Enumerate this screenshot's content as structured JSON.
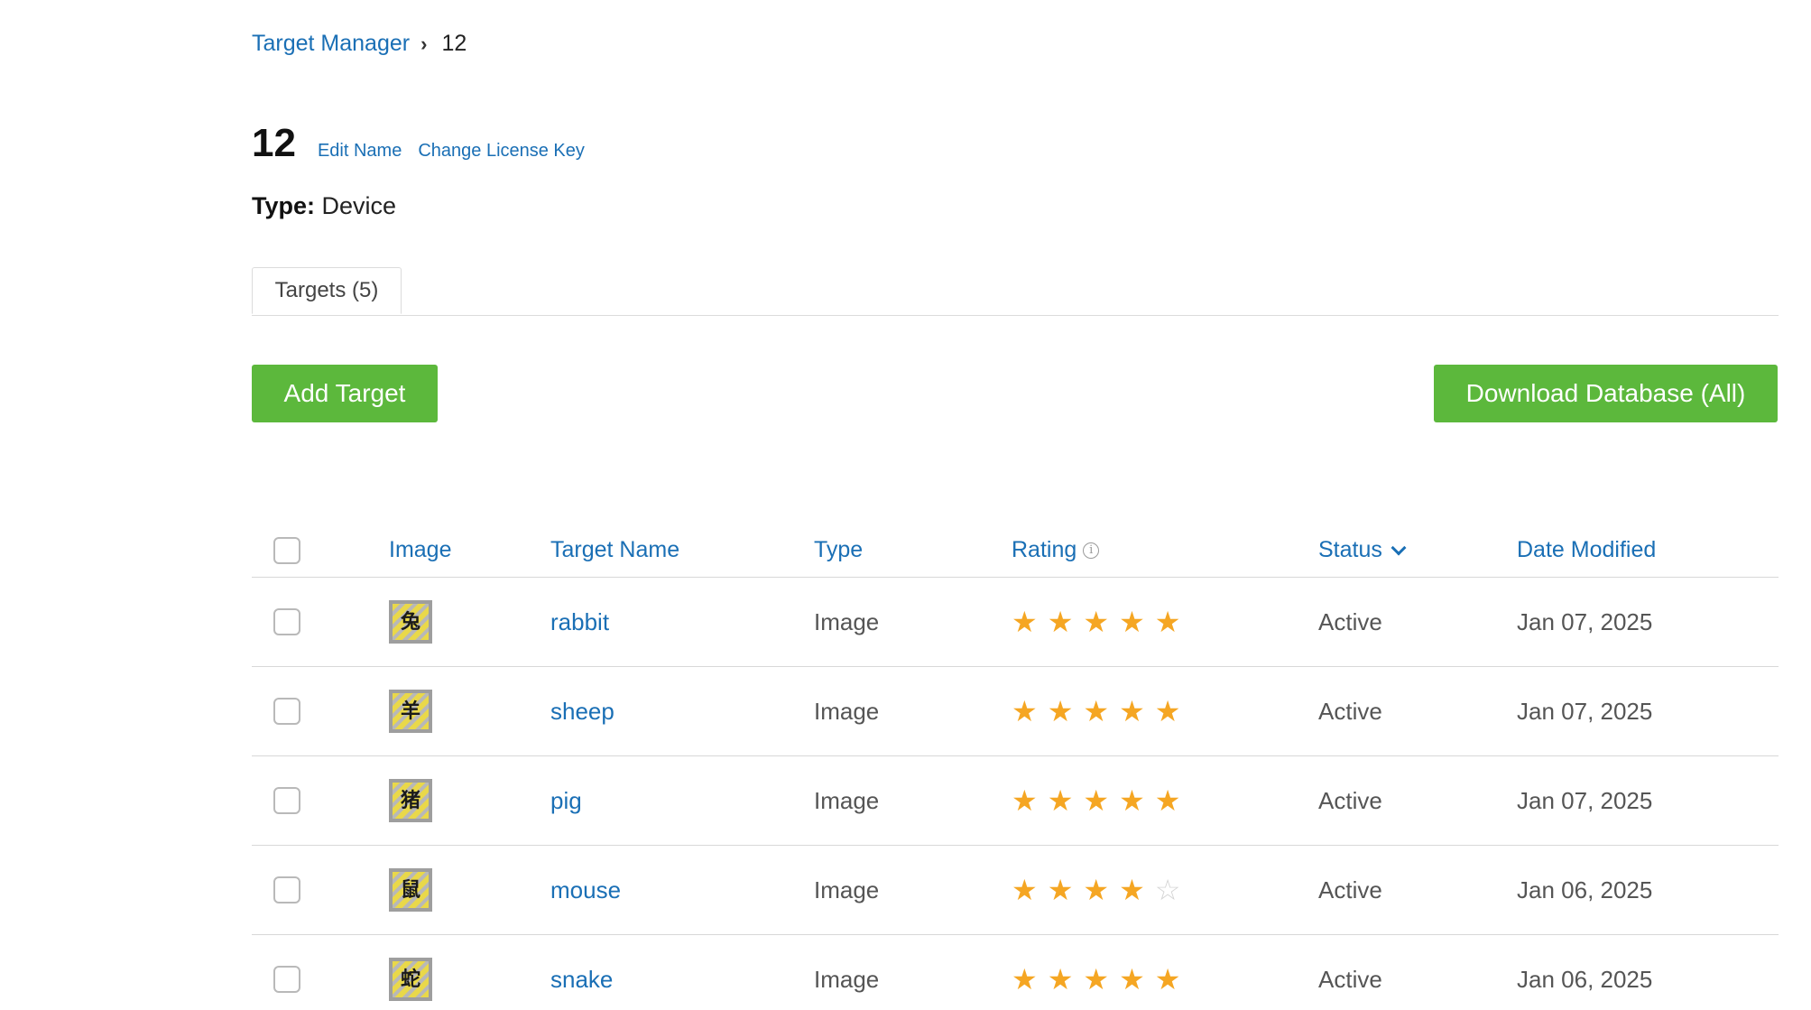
{
  "breadcrumb": {
    "parent": "Target Manager",
    "separator": "›",
    "current": "12"
  },
  "header": {
    "title": "12",
    "edit_name": "Edit Name",
    "change_license_key": "Change License Key",
    "type_label": "Type:",
    "type_value": "Device"
  },
  "tabs": [
    {
      "label": "Targets (5)",
      "active": true
    }
  ],
  "actions": {
    "add_target": "Add Target",
    "download_database": "Download Database (All)"
  },
  "colors": {
    "accent_link": "#1a6fb5",
    "button_green": "#5cb83c",
    "star_gold": "#f5a623",
    "star_empty": "#d4d4d4"
  },
  "table": {
    "columns": {
      "image": "Image",
      "target_name": "Target Name",
      "type": "Type",
      "rating": "Rating",
      "status": "Status",
      "date_modified": "Date Modified"
    },
    "icons": {
      "rating_info": "info-icon",
      "status_sort": "chevron-down-icon"
    },
    "rows": [
      {
        "name": "rabbit",
        "type": "Image",
        "rating": 5,
        "status": "Active",
        "date": "Jan 07, 2025"
      },
      {
        "name": "sheep",
        "type": "Image",
        "rating": 5,
        "status": "Active",
        "date": "Jan 07, 2025"
      },
      {
        "name": "pig",
        "type": "Image",
        "rating": 5,
        "status": "Active",
        "date": "Jan 07, 2025"
      },
      {
        "name": "mouse",
        "type": "Image",
        "rating": 4,
        "status": "Active",
        "date": "Jan 06, 2025"
      },
      {
        "name": "snake",
        "type": "Image",
        "rating": 5,
        "status": "Active",
        "date": "Jan 06, 2025"
      }
    ]
  }
}
